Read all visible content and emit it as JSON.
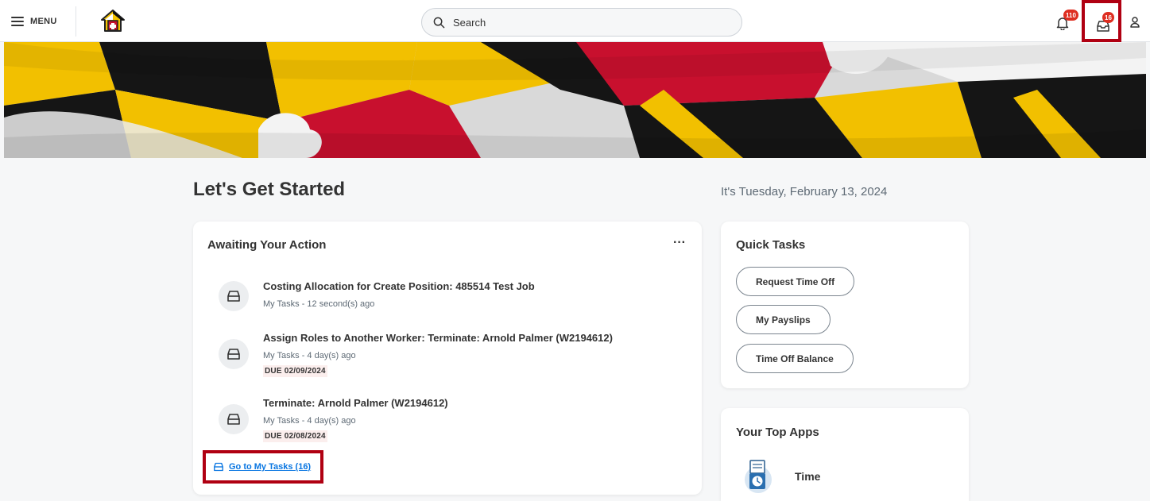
{
  "header": {
    "menu_label": "MENU",
    "search_placeholder": "Search",
    "notifications_count": "110",
    "inbox_count": "16"
  },
  "greeting": "Let's Get Started",
  "date": "It's Tuesday, February 13, 2024",
  "awaiting": {
    "title": "Awaiting Your Action",
    "more_label": "···",
    "tasks": [
      {
        "title": "Costing Allocation for Create Position: 485514 Test Job",
        "meta": "My Tasks - 12 second(s) ago",
        "due": ""
      },
      {
        "title": "Assign Roles to Another Worker: Terminate: Arnold Palmer (W2194612)",
        "meta": "My Tasks - 4 day(s) ago",
        "due": "DUE 02/09/2024"
      },
      {
        "title": "Terminate: Arnold Palmer (W2194612)",
        "meta": "My Tasks - 4 day(s) ago",
        "due": "DUE 02/08/2024"
      }
    ],
    "goto_label": "Go to My Tasks (16)"
  },
  "quick_tasks": {
    "title": "Quick Tasks",
    "buttons": [
      "Request Time Off",
      "My Payslips",
      "Time Off Balance"
    ]
  },
  "top_apps": {
    "title": "Your Top Apps",
    "apps": [
      "Time"
    ]
  },
  "colors": {
    "accent_link": "#0875e1",
    "badge": "#de2e21",
    "highlight_border": "#b00012"
  }
}
